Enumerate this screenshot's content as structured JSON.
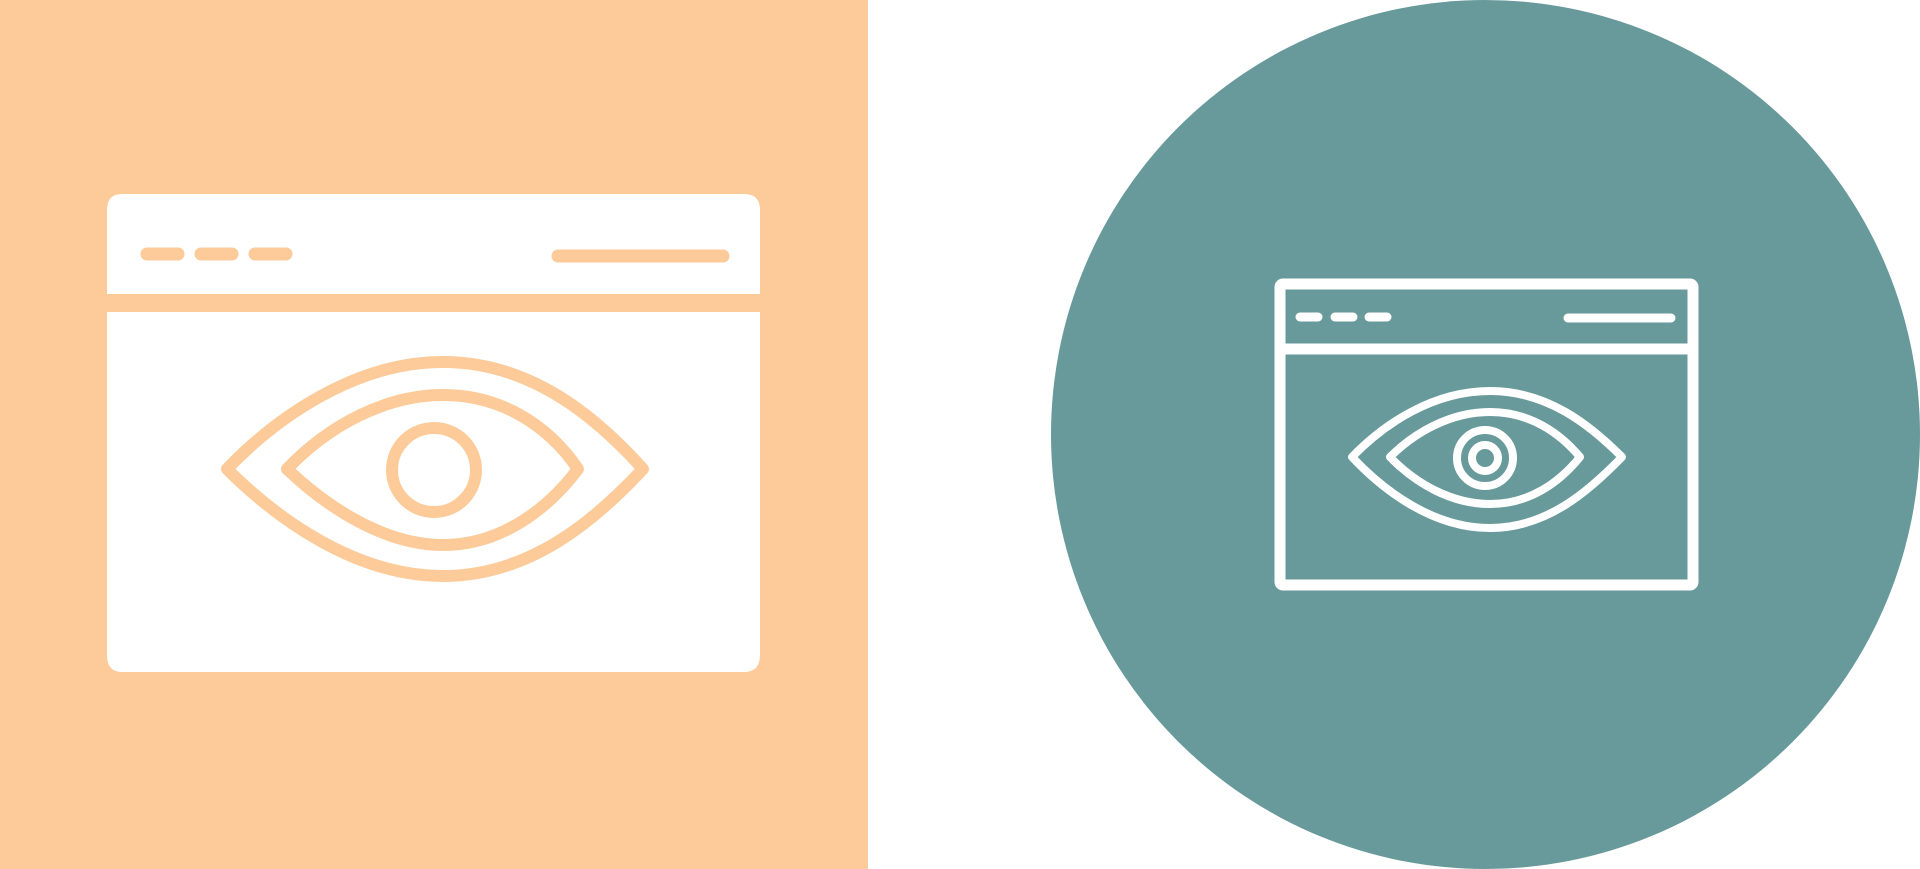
{
  "colors": {
    "page_background": "#ffffff",
    "peach": "#fccb99",
    "teal": "#689a9b",
    "white": "#ffffff"
  },
  "icons": [
    {
      "name": "browser-eye-icon",
      "style": "glyph",
      "background_shape": "square",
      "background_color": "#fccb99",
      "icon_color": "#ffffff",
      "detail_color": "#fccb99"
    },
    {
      "name": "browser-eye-icon",
      "style": "line",
      "background_shape": "circle",
      "background_color": "#689a9b",
      "icon_color": "#ffffff"
    }
  ]
}
